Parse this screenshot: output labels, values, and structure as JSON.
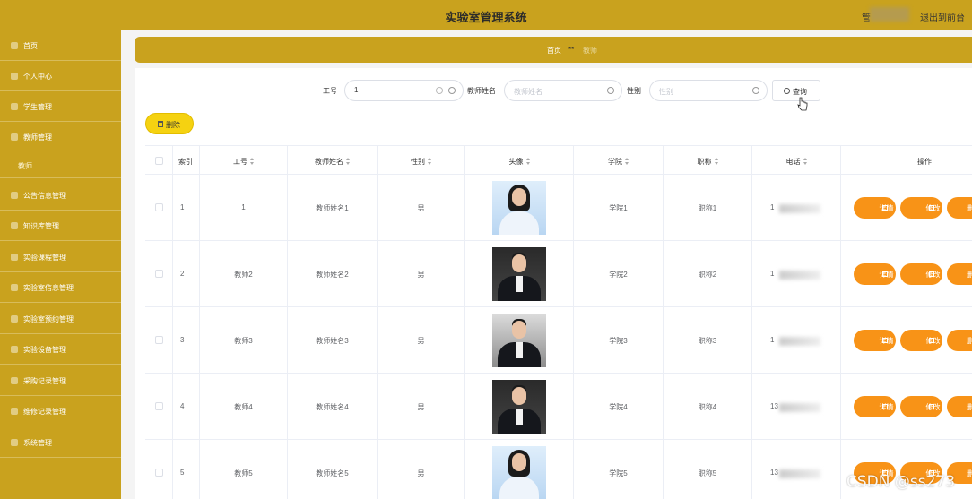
{
  "header": {
    "title": "实验室管理系统",
    "user_label": "管",
    "logout": "退出到前台"
  },
  "sidebar": {
    "items": [
      {
        "label": "首页",
        "icon": "home-icon"
      },
      {
        "label": "个人中心",
        "icon": "user-icon"
      },
      {
        "label": "学生管理",
        "icon": "student-icon"
      },
      {
        "label": "教师管理",
        "icon": "teacher-icon"
      },
      {
        "label": "公告信息管理",
        "icon": "notice-icon"
      },
      {
        "label": "知识库管理",
        "icon": "book-icon"
      },
      {
        "label": "实验课程管理",
        "icon": "course-icon"
      },
      {
        "label": "实验室信息管理",
        "icon": "lab-icon"
      },
      {
        "label": "实验室预约管理",
        "icon": "calendar-icon"
      },
      {
        "label": "实验设备管理",
        "icon": "device-icon"
      },
      {
        "label": "采购记录管理",
        "icon": "cart-icon"
      },
      {
        "label": "维修记录管理",
        "icon": "wrench-icon"
      },
      {
        "label": "系统管理",
        "icon": "gear-icon"
      }
    ],
    "subitem": "教师"
  },
  "breadcrumb": {
    "home": "首页",
    "separator": "**",
    "current": "教师"
  },
  "search": {
    "gonghao_label": "工号",
    "gonghao_value": "1",
    "name_label": "教师姓名",
    "name_placeholder": "教师姓名",
    "gender_label": "性别",
    "gender_placeholder": "性别",
    "button": "查询"
  },
  "toolbar": {
    "delete": "删除"
  },
  "table": {
    "headers": [
      "索引",
      "工号",
      "教师姓名",
      "性别",
      "头像",
      "学院",
      "职称",
      "电话",
      "操作"
    ],
    "rows": [
      {
        "index": "1",
        "gonghao": "1",
        "name": "教师姓名1",
        "gender": "男",
        "college": "学院1",
        "title": "职称1",
        "phone": "1"
      },
      {
        "index": "2",
        "gonghao": "教师2",
        "name": "教师姓名2",
        "gender": "男",
        "college": "学院2",
        "title": "职称2",
        "phone": "1"
      },
      {
        "index": "3",
        "gonghao": "教师3",
        "name": "教师姓名3",
        "gender": "男",
        "college": "学院3",
        "title": "职称3",
        "phone": "1"
      },
      {
        "index": "4",
        "gonghao": "教师4",
        "name": "教师姓名4",
        "gender": "男",
        "college": "学院4",
        "title": "职称4",
        "phone": "13"
      },
      {
        "index": "5",
        "gonghao": "教师5",
        "name": "教师姓名5",
        "gender": "男",
        "college": "学院5",
        "title": "职称5",
        "phone": "13"
      }
    ],
    "actions": {
      "detail": "详情",
      "edit": "修改",
      "delete": "删除"
    }
  },
  "watermark": "CSDN @ss273",
  "colors": {
    "theme": "#c9a21e",
    "action": "#f89317",
    "delete_button": "#f5d211"
  }
}
